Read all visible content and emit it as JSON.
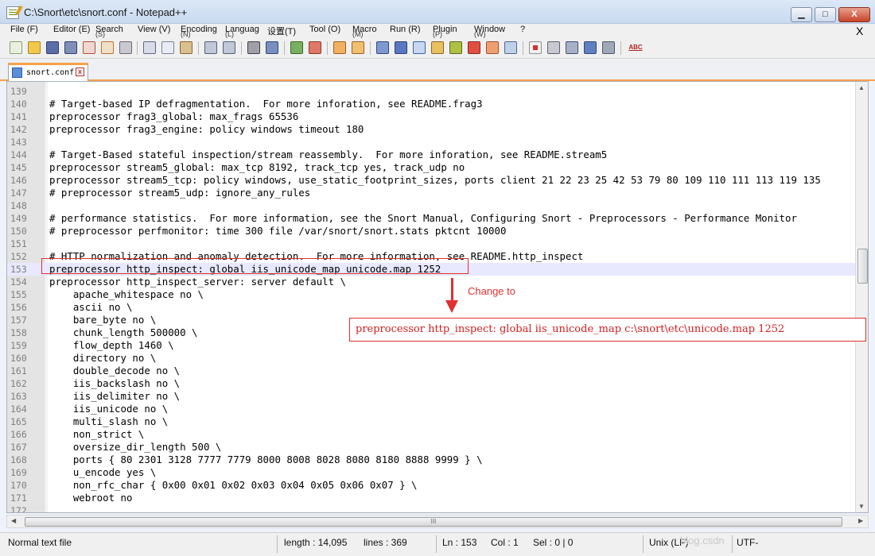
{
  "window": {
    "title": "C:\\Snort\\etc\\snort.conf - Notepad++",
    "min_glyph": "▁",
    "max_glyph": "□",
    "close_glyph": "X"
  },
  "menubar": {
    "items": [
      {
        "label": "File (F)"
      },
      {
        "label": "Editor (E)"
      },
      {
        "label": "Search"
      },
      {
        "label": "View (V)"
      },
      {
        "label": "Encoding"
      },
      {
        "label": "Languag"
      },
      {
        "label": "设置(T)"
      },
      {
        "label": "Tool (O)"
      },
      {
        "label": "Macro"
      },
      {
        "label": "Run (R)"
      },
      {
        "label": "Plugin"
      },
      {
        "label": "Window"
      },
      {
        "label": "?"
      }
    ],
    "subs": [
      {
        "label": "(S)"
      },
      {
        "label": "(N)"
      },
      {
        "label": "(L)"
      },
      {
        "label": "(M)"
      },
      {
        "label": "(P)"
      },
      {
        "label": "(W)"
      }
    ],
    "close_glyph": "X"
  },
  "toolbar": {
    "abc_label": "ABC"
  },
  "tab": {
    "label": "snort.conf",
    "close_glyph": "x"
  },
  "editor": {
    "lines": [
      {
        "num": "139",
        "text": ""
      },
      {
        "num": "140",
        "text": "# Target-based IP defragmentation.  For more inforation, see README.frag3"
      },
      {
        "num": "141",
        "text": "preprocessor frag3_global: max_frags 65536"
      },
      {
        "num": "142",
        "text": "preprocessor frag3_engine: policy windows timeout 180"
      },
      {
        "num": "143",
        "text": ""
      },
      {
        "num": "144",
        "text": "# Target-Based stateful inspection/stream reassembly.  For more inforation, see README.stream5"
      },
      {
        "num": "145",
        "text": "preprocessor stream5_global: max_tcp 8192, track_tcp yes, track_udp no"
      },
      {
        "num": "146",
        "text": "preprocessor stream5_tcp: policy windows, use_static_footprint_sizes, ports client 21 22 23 25 42 53 79 80 109 110 111 113 119 135"
      },
      {
        "num": "147",
        "text": "# preprocessor stream5_udp: ignore_any_rules"
      },
      {
        "num": "148",
        "text": ""
      },
      {
        "num": "149",
        "text": "# performance statistics.  For more information, see the Snort Manual, Configuring Snort - Preprocessors - Performance Monitor"
      },
      {
        "num": "150",
        "text": "# preprocessor perfmonitor: time 300 file /var/snort/snort.stats pktcnt 10000"
      },
      {
        "num": "151",
        "text": ""
      },
      {
        "num": "152",
        "text": "# HTTP normalization and anomaly detection.  For more information, see README.http_inspect"
      },
      {
        "num": "153",
        "text": "preprocessor http_inspect: global iis_unicode_map unicode.map 1252"
      },
      {
        "num": "154",
        "text": "preprocessor http_inspect_server: server default \\"
      },
      {
        "num": "155",
        "text": "    apache_whitespace no \\"
      },
      {
        "num": "156",
        "text": "    ascii no \\"
      },
      {
        "num": "157",
        "text": "    bare_byte no \\"
      },
      {
        "num": "158",
        "text": "    chunk_length 500000 \\"
      },
      {
        "num": "159",
        "text": "    flow_depth 1460 \\"
      },
      {
        "num": "160",
        "text": "    directory no \\"
      },
      {
        "num": "161",
        "text": "    double_decode no \\"
      },
      {
        "num": "162",
        "text": "    iis_backslash no \\"
      },
      {
        "num": "163",
        "text": "    iis_delimiter no \\"
      },
      {
        "num": "164",
        "text": "    iis_unicode no \\"
      },
      {
        "num": "165",
        "text": "    multi_slash no \\"
      },
      {
        "num": "166",
        "text": "    non_strict \\"
      },
      {
        "num": "167",
        "text": "    oversize_dir_length 500 \\"
      },
      {
        "num": "168",
        "text": "    ports { 80 2301 3128 7777 7779 8000 8008 8028 8080 8180 8888 9999 } \\"
      },
      {
        "num": "169",
        "text": "    u_encode yes \\"
      },
      {
        "num": "170",
        "text": "    non_rfc_char { 0x00 0x01 0x02 0x03 0x04 0x05 0x06 0x07 } \\"
      },
      {
        "num": "171",
        "text": "    webroot no"
      },
      {
        "num": "172",
        "text": ""
      }
    ],
    "current_line": "153"
  },
  "annotation": {
    "change_label": "Change to",
    "replacement": "preprocessor http_inspect: global iis_unicode_map c:\\snort\\etc\\unicode.map 1252",
    "color": "#e03030"
  },
  "scrollbar": {
    "up_glyph": "▲",
    "down_glyph": "▼",
    "left_glyph": "◀",
    "right_glyph": "▶",
    "grip_glyph": "III"
  },
  "statusbar": {
    "file_type": "Normal text file",
    "length": "length : 14,095",
    "lines": "lines : 369",
    "ln": "Ln : 153",
    "col": "Col : 1",
    "sel": "Sel : 0 | 0",
    "eol": "Unix (LF)",
    "encoding": "UTF-",
    "watermark": "blog.csdn"
  },
  "colors": {
    "accent_tab": "#f8a04a",
    "current_line_bg": "#e8e8ff",
    "annotation": "#e03030"
  }
}
